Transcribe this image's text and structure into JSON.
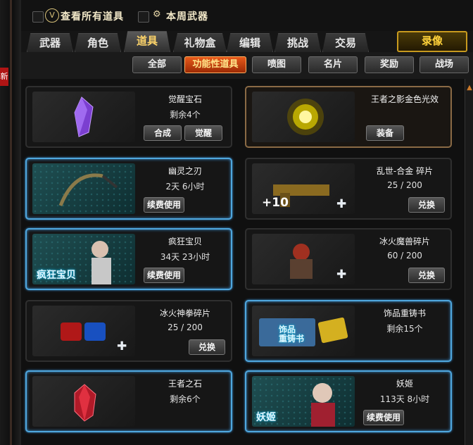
{
  "left_strip": {
    "tab_char": "新"
  },
  "filters": {
    "view_all_items": "查看所有道具",
    "weekly_weapons": "本周武器"
  },
  "tabs": [
    "武器",
    "角色",
    "道具",
    "礼物盒",
    "编辑",
    "挑战",
    "交易"
  ],
  "active_tab": "道具",
  "record_button": "录像",
  "sub_tabs": [
    "全部",
    "功能性道具",
    "喷图",
    "名片",
    "奖励",
    "战场"
  ],
  "active_sub_tab": "功能性道具",
  "items": [
    {
      "name": "觉醒宝石",
      "status": "剩余4个",
      "buttons": [
        "合成",
        "觉醒"
      ]
    },
    {
      "name": "王者之影金色光效",
      "status": "",
      "buttons": [
        "装备"
      ]
    },
    {
      "name": "幽灵之刃",
      "status": "2天 6小时",
      "buttons": [
        "续费使用"
      ]
    },
    {
      "name": "乱世-合金 碎片",
      "status": "25 / 200",
      "buttons": [
        "兑换"
      ],
      "thumb_label": "+10"
    },
    {
      "name": "疯狂宝贝",
      "status": "34天 23小时",
      "buttons": [
        "续费使用"
      ],
      "thumb_label": "疯狂宝贝"
    },
    {
      "name": "冰火魔兽碎片",
      "status": "60 / 200",
      "buttons": [
        "兑换"
      ]
    },
    {
      "name": "冰火神拳碎片",
      "status": "25 / 200",
      "buttons": [
        "兑换"
      ]
    },
    {
      "name": "饰品重铸书",
      "status": "剩余15个",
      "buttons": [],
      "thumb_label": "饰品\n重铸书"
    },
    {
      "name": "王者之石",
      "status": "剩余6个",
      "buttons": []
    },
    {
      "name": "妖姬",
      "status": "113天 8小时",
      "buttons": [
        "续费使用"
      ],
      "thumb_label": "妖姬"
    }
  ],
  "colors": {
    "selected_border": "#4fa7de",
    "active_subtab": "#e75a1a",
    "gold": "#c89a1e"
  }
}
